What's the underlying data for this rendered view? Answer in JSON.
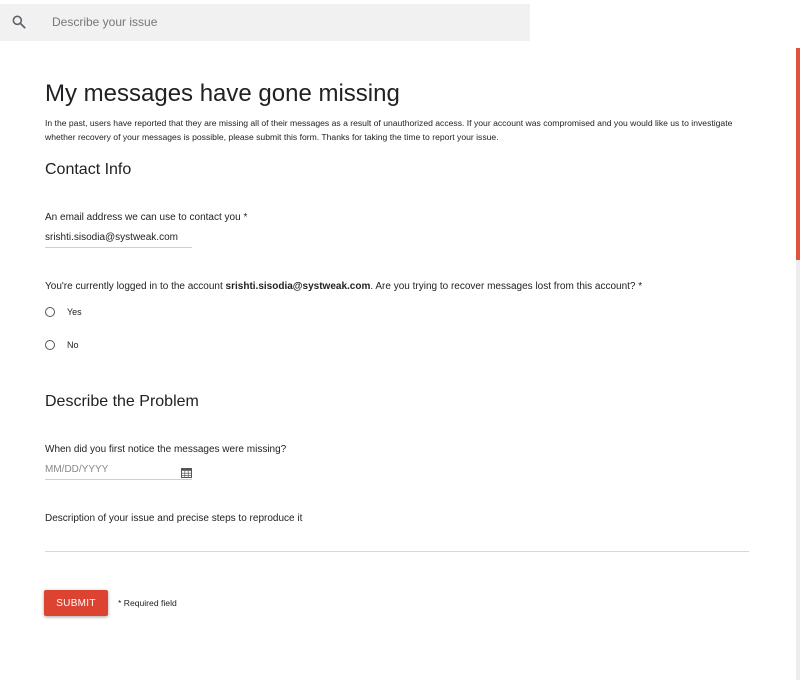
{
  "search": {
    "placeholder": "Describe your issue"
  },
  "form": {
    "title": "My messages have gone missing",
    "intro": "In the past, users have reported that they are missing all of their messages as a result of unauthorized access. If your account was compromised and you would like us to investigate whether recovery of your messages is possible, please submit this form. Thanks for taking the time to report your issue.",
    "contact_section": {
      "title": "Contact Info",
      "email_label": "An email address we can use to contact you *",
      "email_value": "srishti.sisodia@systweak.com",
      "account_question_prefix": "You're currently logged in to the account ",
      "account_email": "srishti.sisodia@systweak.com",
      "account_question_suffix": ". Are you trying to recover messages lost from this account? *",
      "options": [
        "Yes",
        "No"
      ]
    },
    "problem_section": {
      "title": "Describe the Problem",
      "date_label": "When did you first notice the messages were missing?",
      "date_placeholder": "MM/DD/YYYY",
      "description_label": "Description of your issue and precise steps to reproduce it"
    },
    "submit_label": "SUBMIT",
    "required_note": "* Required field"
  },
  "colors": {
    "accent": "#dc4431",
    "scroll_accent": "#e0533e"
  }
}
